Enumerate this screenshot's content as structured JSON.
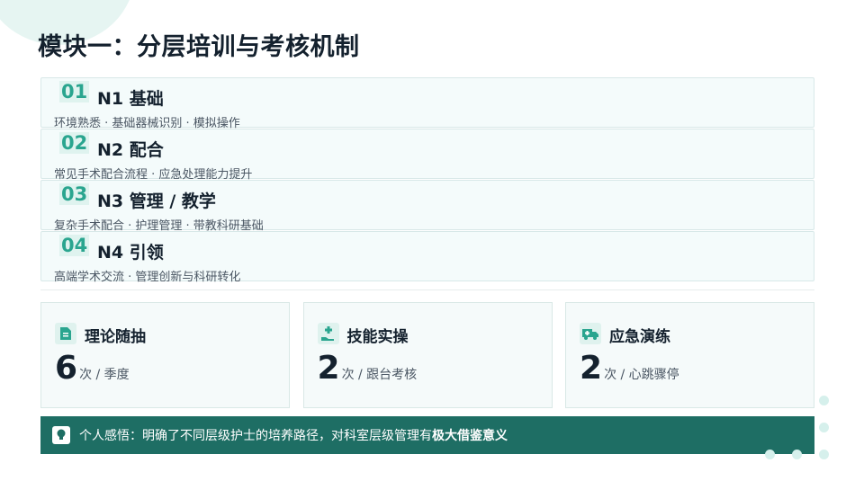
{
  "title": "模块一：分层培训与考核机制",
  "levels": [
    {
      "num": "01",
      "name": "N1  基础",
      "desc": "环境熟悉 · 基础器械识别 · 模拟操作"
    },
    {
      "num": "02",
      "name": "N2  配合",
      "desc": "常见手术配合流程 · 应急处理能力提升"
    },
    {
      "num": "03",
      "name": "N3  管理 / 教学",
      "desc": "复杂手术配合 · 护理管理 · 带教科研基础"
    },
    {
      "num": "04",
      "name": "N4  引领",
      "desc": "高端学术交流 · 管理创新与科研转化"
    }
  ],
  "cards": [
    {
      "icon": "document-icon",
      "title": "理论随抽",
      "num": "6",
      "unit": "次 / 季度"
    },
    {
      "icon": "hand-plus-icon",
      "title": "技能实操",
      "num": "2",
      "unit": "次 / 跟台考核"
    },
    {
      "icon": "ambulance-icon",
      "title": "应急演练",
      "num": "2",
      "unit": "次 / 心跳骤停"
    }
  ],
  "banner": {
    "icon": "lightbulb-icon",
    "text": "个人感悟：明确了不同层级护士的培养路径，对科室层级管理有",
    "emphasis": "极大借鉴意义"
  },
  "colors": {
    "accent": "#2aa58f",
    "banner": "#1e6e64",
    "title": "#14212e"
  }
}
